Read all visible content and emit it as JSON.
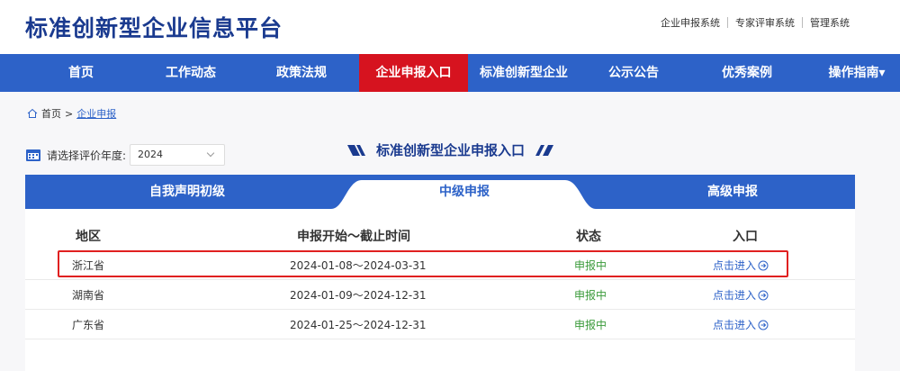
{
  "site": {
    "title": "标准创新型企业信息平台"
  },
  "top_links": [
    "企业申报系统",
    "专家评审系统",
    "管理系统"
  ],
  "nav": {
    "items": [
      "首页",
      "工作动态",
      "政策法规",
      "企业申报入口",
      "标准创新型企业",
      "公示公告",
      "优秀案例",
      "操作指南▾"
    ],
    "active_index": 3,
    "active_color": "#d6131f",
    "bar_color": "#2d62c8"
  },
  "breadcrumb": {
    "home": "首页",
    "separator": ">",
    "current": "企业申报"
  },
  "year_filter": {
    "label": "请选择评价年度:",
    "selected": "2024"
  },
  "entry_title": "标准创新型企业申报入口",
  "tabs": {
    "items": [
      "自我声明初级",
      "中级申报",
      "高级申报"
    ],
    "active_index": 1
  },
  "table": {
    "headers": [
      "地区",
      "申报开始～截止时间",
      "状态",
      "入口"
    ],
    "rows": [
      {
        "region": "浙江省",
        "period": "2024-01-08～2024-03-31",
        "status": "申报中",
        "entry": "点击进入",
        "highlighted": true
      },
      {
        "region": "湖南省",
        "period": "2024-01-09～2024-12-31",
        "status": "申报中",
        "entry": "点击进入",
        "highlighted": false
      },
      {
        "region": "广东省",
        "period": "2024-01-25～2024-12-31",
        "status": "申报中",
        "entry": "点击进入",
        "highlighted": false
      }
    ]
  },
  "colors": {
    "brand_blue": "#2d62c8",
    "title_blue": "#1a3a8f",
    "status_green": "#3a9a3a",
    "highlight_red": "#e02020"
  }
}
